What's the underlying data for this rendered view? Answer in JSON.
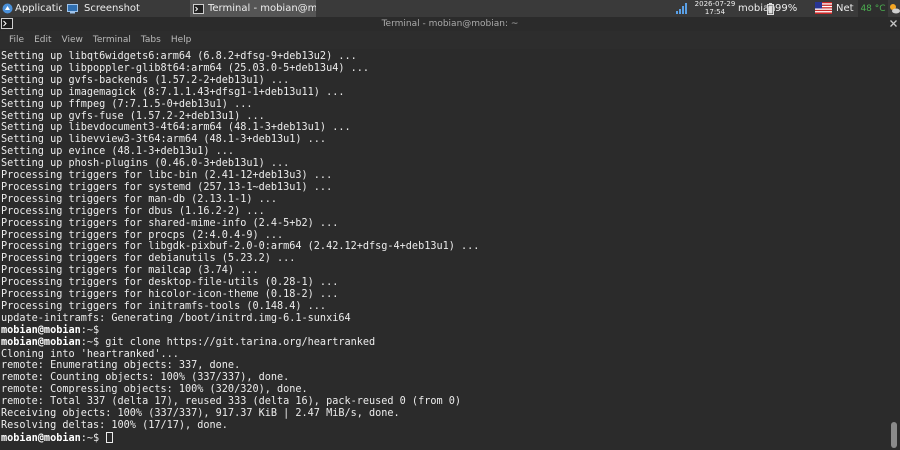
{
  "panel": {
    "apps_label": "Applications",
    "tasks": [
      {
        "label": "Screenshot",
        "active": false
      },
      {
        "label": "Terminal - mobian@mobia...",
        "active": true
      }
    ],
    "date": "2026-07-29",
    "time": "17:54",
    "user": "mobian",
    "battery": "99%",
    "net": "Net",
    "temp": "48 °C"
  },
  "window": {
    "title": "Terminal - mobian@mobian: ~",
    "menu": [
      "File",
      "Edit",
      "View",
      "Terminal",
      "Tabs",
      "Help"
    ]
  },
  "terminal": {
    "prompt": "mobian@mobian",
    "lines": [
      {
        "text": "Setting up libqt6widgets6:arm64 (6.8.2+dfsg-9+deb13u2) ..."
      },
      {
        "text": "Setting up libpoppler-glib8t64:arm64 (25.03.0-5+deb13u4) ..."
      },
      {
        "text": "Setting up gvfs-backends (1.57.2-2+deb13u1) ..."
      },
      {
        "text": "Setting up imagemagick (8:7.1.1.43+dfsg1-1+deb13u11) ..."
      },
      {
        "text": "Setting up ffmpeg (7:7.1.5-0+deb13u1) ..."
      },
      {
        "text": "Setting up gvfs-fuse (1.57.2-2+deb13u1) ..."
      },
      {
        "text": "Setting up libevdocument3-4t64:arm64 (48.1-3+deb13u1) ..."
      },
      {
        "text": "Setting up libevview3-3t64:arm64 (48.1-3+deb13u1) ..."
      },
      {
        "text": "Setting up evince (48.1-3+deb13u1) ..."
      },
      {
        "text": "Setting up phosh-plugins (0.46.0-3+deb13u1) ..."
      },
      {
        "text": "Processing triggers for libc-bin (2.41-12+deb13u3) ..."
      },
      {
        "text": "Processing triggers for systemd (257.13-1~deb13u1) ..."
      },
      {
        "text": "Processing triggers for man-db (2.13.1-1) ..."
      },
      {
        "text": "Processing triggers for dbus (1.16.2-2) ..."
      },
      {
        "text": "Processing triggers for shared-mime-info (2.4-5+b2) ..."
      },
      {
        "text": "Processing triggers for procps (2:4.0.4-9) ..."
      },
      {
        "text": "Processing triggers for libgdk-pixbuf-2.0-0:arm64 (2.42.12+dfsg-4+deb13u1) ..."
      },
      {
        "text": "Processing triggers for debianutils (5.23.2) ..."
      },
      {
        "text": "Processing triggers for mailcap (3.74) ..."
      },
      {
        "text": "Processing triggers for desktop-file-utils (0.28-1) ..."
      },
      {
        "text": "Processing triggers for hicolor-icon-theme (0.18-2) ..."
      },
      {
        "text": "Processing triggers for initramfs-tools (0.148.4) ..."
      },
      {
        "text": "update-initramfs: Generating /boot/initrd.img-6.1-sunxi64"
      },
      {
        "prompt": "mobian@mobian",
        "text": ":~$ "
      },
      {
        "prompt": "mobian@mobian",
        "text": ":~$ git clone https://git.tarina.org/heartranked"
      },
      {
        "text": "Cloning into 'heartranked'..."
      },
      {
        "text": "remote: Enumerating objects: 337, done."
      },
      {
        "text": "remote: Counting objects: 100% (337/337), done."
      },
      {
        "text": "remote: Compressing objects: 100% (320/320), done."
      },
      {
        "text": "remote: Total 337 (delta 17), reused 333 (delta 16), pack-reused 0 (from 0)"
      },
      {
        "text": "Receiving objects: 100% (337/337), 917.37 KiB | 2.47 MiB/s, done."
      },
      {
        "text": "Resolving deltas: 100% (17/17), done."
      },
      {
        "prompt": "mobian@mobian",
        "text": ":~$ ",
        "cursor": true
      }
    ]
  },
  "colors": {
    "panel_bg": "#3a3a3a",
    "terminal_bg": "#2b2b2b",
    "terminal_fg": "#ececec",
    "temp_green": "#4caf50"
  }
}
